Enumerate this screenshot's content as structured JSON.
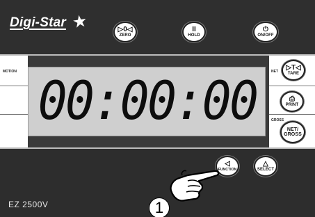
{
  "brand": {
    "name": "Digi-Star"
  },
  "top_buttons": [
    {
      "symbol": "▷0◁",
      "label": "ZERO"
    },
    {
      "symbol": "II",
      "label": "HOLD"
    },
    {
      "symbol": "⏻",
      "label": "ON/OFF"
    }
  ],
  "left_indicators": {
    "motion": "MOTION"
  },
  "right_indicators": {
    "net": "NET",
    "gross": "GROSS"
  },
  "right_buttons": [
    {
      "symbol": "▷T◁",
      "label": "TARE"
    },
    {
      "symbol": "⎙",
      "label": "PRINT"
    },
    {
      "symbol": "NET/",
      "label": "GROSS"
    }
  ],
  "display": {
    "value": "00:00:00"
  },
  "bottom_buttons": [
    {
      "symbol": "◁",
      "label": "FUNCTION"
    },
    {
      "symbol": "△",
      "label": "SELECT"
    }
  ],
  "model": "EZ 2500V",
  "callout": {
    "number": "1"
  },
  "colors": {
    "body": "#2b2b2b",
    "lcd": "#cfcfcf",
    "button": "#ffffff"
  },
  "icons": {
    "hand": "pointing-hand-icon"
  }
}
